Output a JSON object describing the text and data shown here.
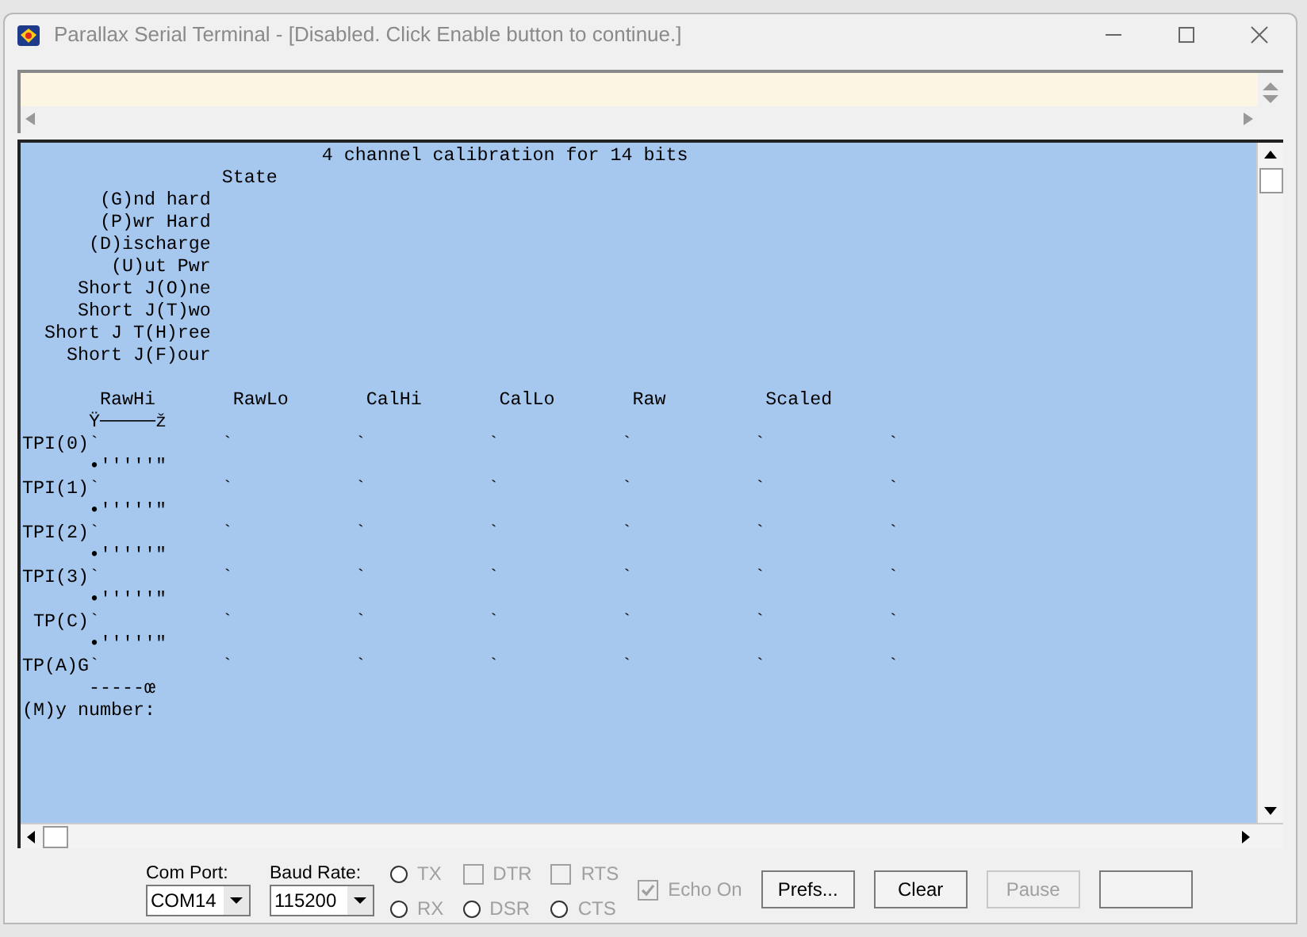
{
  "window": {
    "title": "Parallax Serial Terminal - [Disabled. Click Enable button to continue.]"
  },
  "terminal": {
    "header_lines": [
      "                           4 channel calibration for 14 bits",
      "                  State",
      "       (G)nd hard",
      "       (P)wr Hard",
      "      (D)ischarge",
      "        (U)ut Pwr",
      "     Short J(O)ne",
      "     Short J(T)wo",
      "  Short J T(H)ree",
      "    Short J(F)our"
    ],
    "table_lines": [
      "       RawHi       RawLo       CalHi       CalLo       Raw         Scaled",
      "      Ÿ─────ž",
      "TPI(0)`           `           `           `           `           `           `",
      "      •′′′′′″",
      "TPI(1)`           `           `           `           `           `           `",
      "      •′′′′′″",
      "TPI(2)`           `           `           `           `           `           `",
      "      •′′′′′″",
      "TPI(3)`           `           `           `           `           `           `",
      "      •′′′′′″",
      " TP(C)`           `           `           `           `           `           `",
      "      •′′′′′″",
      "TP(A)G`           `           `           `           `           `           `",
      "      -----œ",
      "(M)y number:"
    ]
  },
  "controls": {
    "com_port": {
      "label": "Com Port:",
      "value": "COM14"
    },
    "baud_rate": {
      "label": "Baud Rate:",
      "value": "115200"
    },
    "indicators": [
      {
        "kind": "radio",
        "label": "TX",
        "checked": false
      },
      {
        "kind": "checkbox",
        "label": "DTR",
        "checked": false
      },
      {
        "kind": "checkbox",
        "label": "RTS",
        "checked": false
      },
      {
        "kind": "radio",
        "label": "RX",
        "checked": false
      },
      {
        "kind": "radio",
        "label": "DSR",
        "checked": false
      },
      {
        "kind": "radio",
        "label": "CTS",
        "checked": false
      }
    ],
    "echo": {
      "label": "Echo On",
      "checked": true,
      "disabled": true
    },
    "buttons": [
      {
        "label": "Prefs...",
        "disabled": false
      },
      {
        "label": "Clear",
        "disabled": false
      },
      {
        "label": "Pause",
        "disabled": true
      },
      {
        "disabled": false
      }
    ]
  }
}
